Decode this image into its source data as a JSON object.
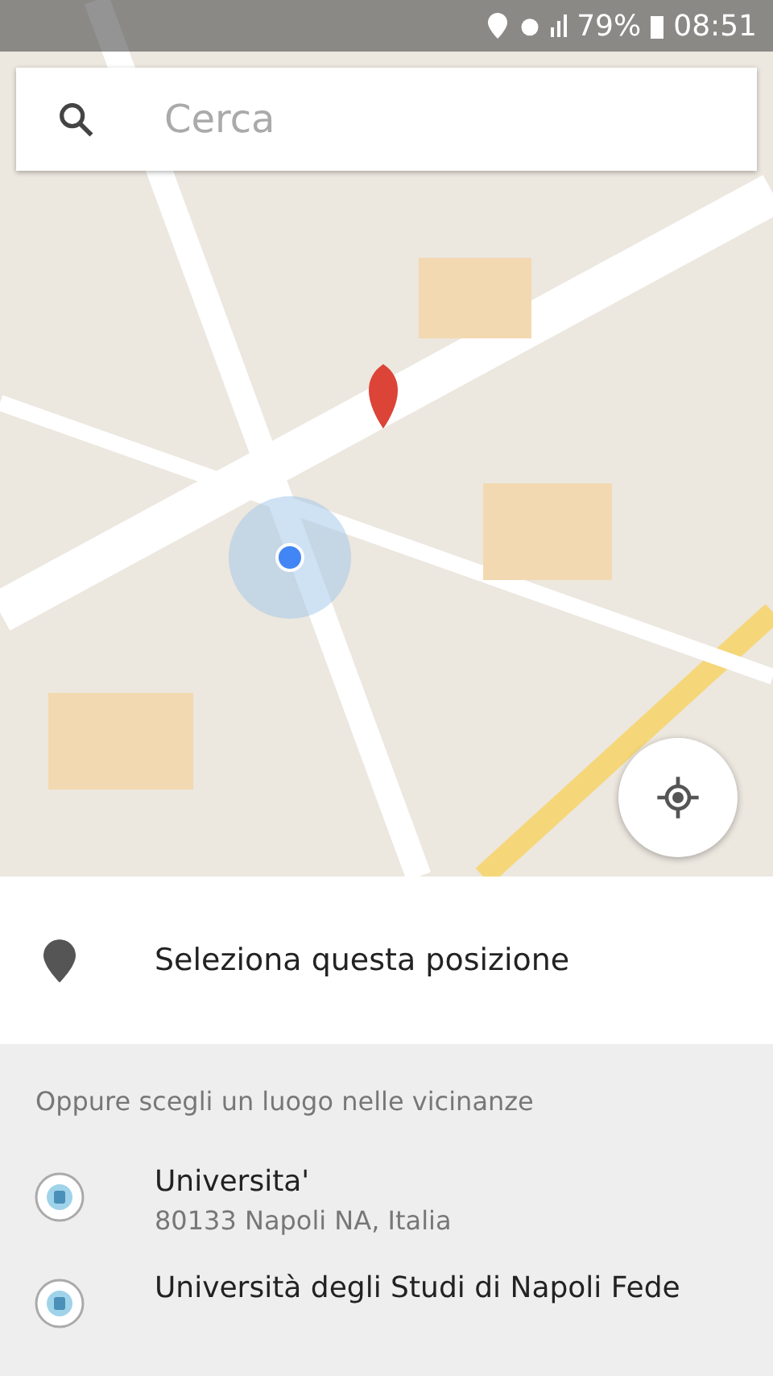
{
  "status_bar": {
    "battery": "79%",
    "time": "08:51"
  },
  "search": {
    "placeholder": "Cerca"
  },
  "select_row": {
    "label": "Seleziona questa posizione"
  },
  "nearby": {
    "heading": "Oppure scegli un luogo nelle vicinanze",
    "places": [
      {
        "name": "Universita'",
        "address": "80133 Napoli NA, Italia"
      },
      {
        "name": "Università degli Studi di Napoli Fede"
      }
    ]
  }
}
